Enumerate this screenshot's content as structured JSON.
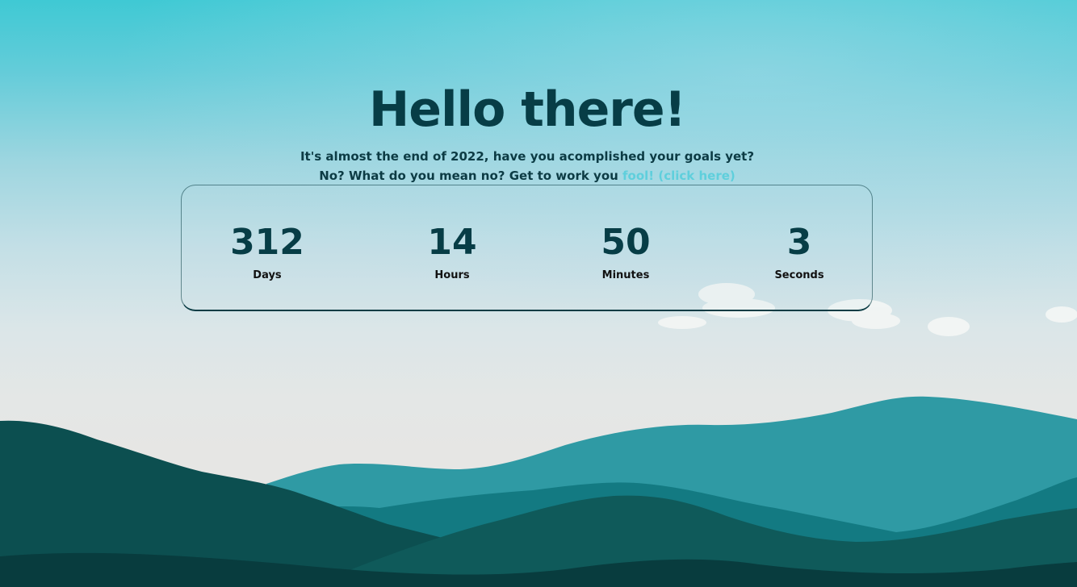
{
  "page": {
    "title": "Hello there!",
    "subtitle_line1": "It's almost the end of 2022, have you acomplished your goals yet?",
    "subtitle_line2_prefix": "No? What do you mean no? Get to work you ",
    "subtitle_link": "fool! (click here)"
  },
  "countdown": {
    "units": [
      {
        "value": "312",
        "label": "Days"
      },
      {
        "value": "14",
        "label": "Hours"
      },
      {
        "value": "50",
        "label": "Minutes"
      },
      {
        "value": "3",
        "label": "Seconds"
      }
    ]
  },
  "colors": {
    "heading": "#073d46",
    "link": "#5fcfdc",
    "mountain_far": "#2f9aa4",
    "mountain_mid": "#137a82",
    "mountain_near": "#0c4f50"
  }
}
